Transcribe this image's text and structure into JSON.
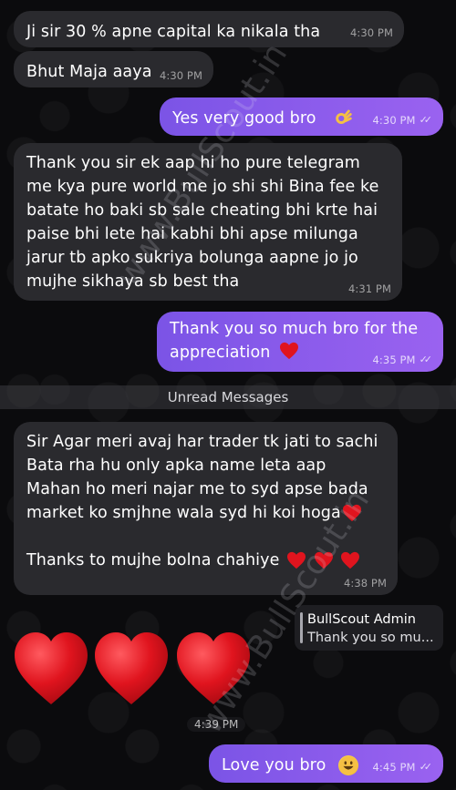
{
  "messages": [
    {
      "id": "m1",
      "side": "in",
      "text": "Ji sir 30 % apne capital ka nikala tha",
      "time": "4:30 PM"
    },
    {
      "id": "m2",
      "side": "in",
      "text": "Bhut Maja aaya",
      "time": "4:30 PM"
    },
    {
      "id": "m3",
      "side": "out",
      "text": "Yes very good bro",
      "time": "4:30 PM"
    },
    {
      "id": "m4",
      "side": "in",
      "text": "Thank you sir ek aap hi ho pure telegram\nme kya pure world me jo shi shi Bina fee ke\nbatate ho baki sb sale cheating bhi krte hai\npaise bhi lete hai kabhi bhi apse milunga\njarur tb apko sukriya bolunga aapne jo jo\nmujhe sikhaya sb best tha",
      "time": "4:31 PM"
    },
    {
      "id": "m5",
      "side": "out",
      "text": "Thank you so much bro for the\nappreciation",
      "time": "4:35 PM"
    },
    {
      "id": "m6",
      "side": "in",
      "text": "Sir Agar meri avaj har trader tk jati to sachi\nBata rha hu only apka name leta aap\nMahan ho meri najar me to syd apse bada\nmarket ko smjhne wala syd hi koi hoga",
      "text2": "Thanks to mujhe bolna chahiye",
      "time": "4:38 PM"
    },
    {
      "id": "m7",
      "side": "in",
      "time": "4:39 PM"
    },
    {
      "id": "m8",
      "side": "out",
      "text": "Love you bro",
      "time": "4:45 PM"
    }
  ],
  "unread_label": "Unread Messages",
  "reply": {
    "name": "BullScout Admin",
    "text": "Thank you so mu..."
  },
  "watermark": "www.BullScout.in",
  "colors": {
    "incoming": "#2a2a2e",
    "outgoing_start": "#7b54e6",
    "outgoing_end": "#9a62f0",
    "heart": "#e0141e"
  }
}
